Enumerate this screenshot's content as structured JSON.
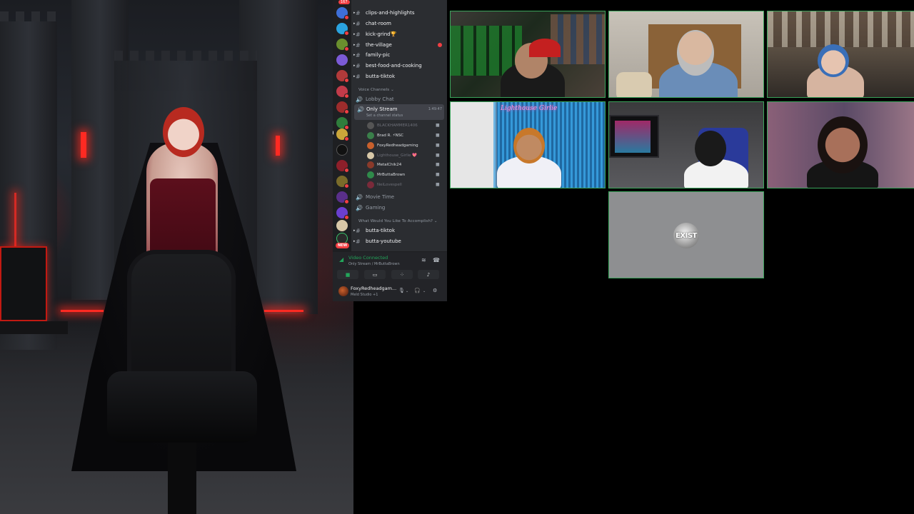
{
  "discord": {
    "top_badge": "167",
    "new_badge": "NEW",
    "text_channels": [
      {
        "name": "clips-and-highlights"
      },
      {
        "name": "chat-room"
      },
      {
        "name": "kick-grind🏆"
      },
      {
        "name": "the-village"
      },
      {
        "name": "family-pic"
      },
      {
        "name": "best-food-and-cooking"
      },
      {
        "name": "butta-tiktok"
      }
    ],
    "voice_section_label": "Voice Channels",
    "lobby_chat": "Lobby Chat",
    "active_voice": {
      "name": "Only Stream",
      "status": "Set a channel status",
      "timer": "1:49:47"
    },
    "members": [
      {
        "name": "BLACKHAMMER1406",
        "dim": true
      },
      {
        "name": "Brad R. ⚡NSC",
        "dim": false
      },
      {
        "name": "FoxyRedheadgaming",
        "dim": false
      },
      {
        "name": "Lighthouse_Girlie 💖",
        "dim": true
      },
      {
        "name": "MetalChik24",
        "dim": false
      },
      {
        "name": "MrButtaBrown",
        "dim": false
      },
      {
        "name": "NeiLovespell",
        "dim": true
      }
    ],
    "movie_time": "Movie Time",
    "gaming": "Gaming",
    "accomplish_section_label": "What Would You Like To Accomplish?",
    "bottom_channels": [
      {
        "name": "butta-tiktok"
      },
      {
        "name": "butta-youtube"
      }
    ],
    "rtc": {
      "title": "Video Connected",
      "subtitle": "Only Stream / MrButtaBrown"
    },
    "user": {
      "name": "FoxyRedheadgam...",
      "status": "Meld Studio +1"
    }
  },
  "video": {
    "neon_sign": "Lighthouse Girlie",
    "placeholder_logo": "EXIST"
  },
  "colors": {
    "tile_border": "#3ba55c",
    "discord_bg": "#2b2d31",
    "discord_rail": "#1e1f22",
    "voice_green": "#23a55a",
    "unread_red": "#f23f43"
  }
}
